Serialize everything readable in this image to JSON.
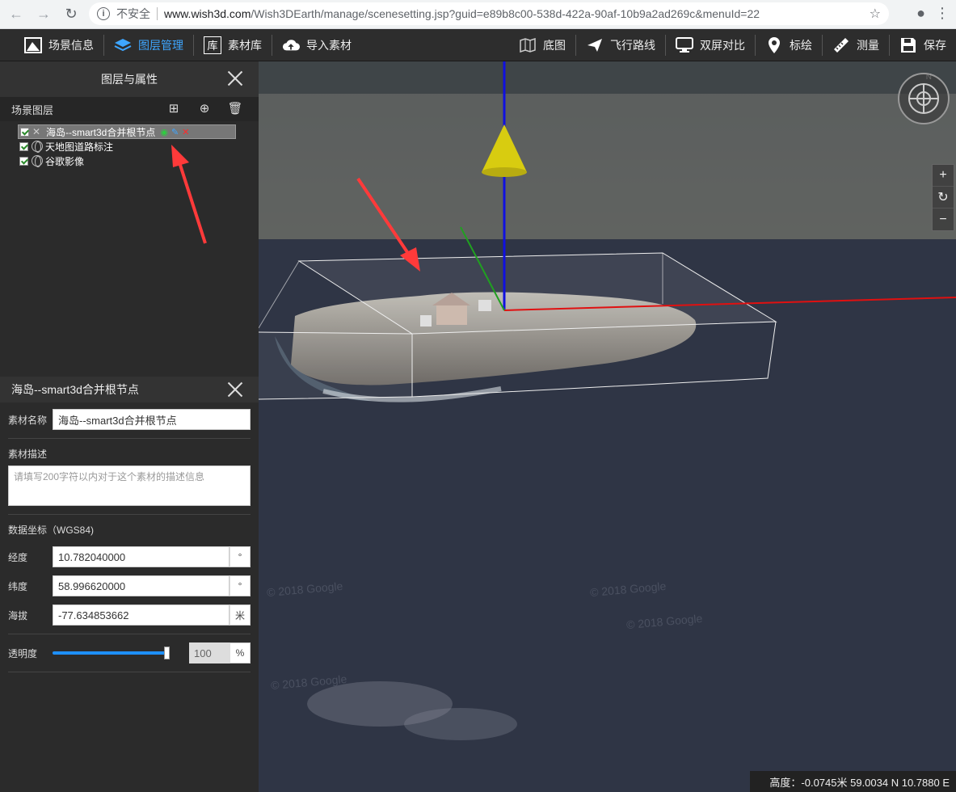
{
  "browser": {
    "insecure_label": "不安全",
    "url_domain": "www.wish3d.com",
    "url_path": "/Wish3DEarth/manage/scenesetting.jsp?guid=e89b8c00-538d-422a-90af-10b9a2ad269c&menuId=22"
  },
  "toolbar": {
    "left": [
      {
        "label": "场景信息",
        "icon": "picture-icon"
      },
      {
        "label": "图层管理",
        "icon": "layers-icon"
      },
      {
        "label": "素材库",
        "icon": "library-icon"
      },
      {
        "label": "导入素材",
        "icon": "upload-icon"
      }
    ],
    "right": [
      {
        "label": "底图",
        "icon": "map-icon"
      },
      {
        "label": "飞行路线",
        "icon": "plane-icon"
      },
      {
        "label": "双屏对比",
        "icon": "monitor-icon"
      },
      {
        "label": "标绘",
        "icon": "pin-icon"
      },
      {
        "label": "测量",
        "icon": "ruler-icon"
      },
      {
        "label": "保存",
        "icon": "save-icon"
      }
    ],
    "library_glyph": "库"
  },
  "layers_panel": {
    "title": "图层与属性",
    "section_label": "场景图层",
    "items": [
      {
        "label": "海岛--smart3d合并根节点",
        "checked": true,
        "selected": true
      },
      {
        "label": "天地图道路标注",
        "checked": true,
        "selected": false
      },
      {
        "label": "谷歌影像",
        "checked": true,
        "selected": false
      }
    ]
  },
  "properties": {
    "title": "海岛--smart3d合并根节点",
    "name_label": "素材名称",
    "name_value": "海岛--smart3d合并根节点",
    "desc_label": "素材描述",
    "desc_placeholder": "请填写200字符以内对于这个素材的描述信息",
    "coord_label": "数据坐标（WGS84)",
    "lon_label": "经度",
    "lon_value": "10.782040000",
    "lon_unit": "°",
    "lat_label": "纬度",
    "lat_value": "58.996620000",
    "lat_unit": "°",
    "alt_label": "海拔",
    "alt_value": "-77.634853662",
    "alt_unit": "米",
    "opacity_label": "透明度",
    "opacity_value": "100",
    "opacity_unit": "%",
    "opacity_fraction": 1.0
  },
  "viewport": {
    "compass_north": "N",
    "zoom_in": "+",
    "reset": "↻",
    "zoom_out": "−",
    "status": "高度：-0.0745米 59.0034 N 10.7880 E",
    "watermarks": [
      "© 2018 Google",
      "© 2018 Google",
      "© 2018 Google",
      "© 2018 Google"
    ]
  }
}
